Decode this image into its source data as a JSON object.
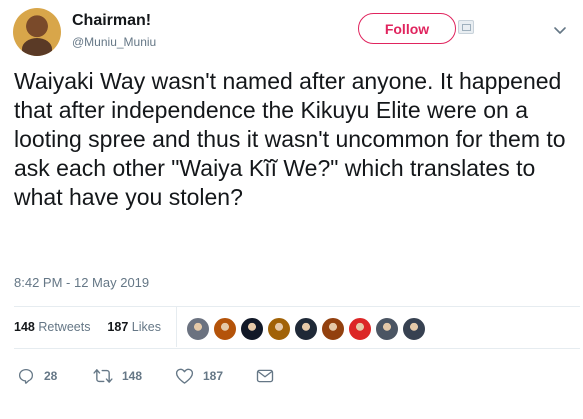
{
  "tweet": {
    "display_name": "Chairman!",
    "handle": "@Muniu_Muniu",
    "follow_label": "Follow",
    "text": "Waiyaki Way wasn't named after anyone. It happened that after independence the Kikuyu Elite were on a looting spree and thus it wasn't uncommon for them to ask each other \"Waiya Kĩĩ We?\" which translates to what have you stolen?",
    "timestamp": "8:42 PM - 12 May 2019"
  },
  "stats": {
    "retweets_count": "148",
    "retweets_label": "Retweets",
    "likes_count": "187",
    "likes_label": "Likes"
  },
  "liker_avatars": [
    {
      "color": "#6b7280"
    },
    {
      "color": "#b45309"
    },
    {
      "color": "#111827"
    },
    {
      "color": "#a16207"
    },
    {
      "color": "#1f2937"
    },
    {
      "color": "#92400e"
    },
    {
      "color": "#dc2626"
    },
    {
      "color": "#4b5563"
    },
    {
      "color": "#374151"
    }
  ],
  "actions": {
    "replies": "28",
    "retweets": "148",
    "likes": "187"
  },
  "colors": {
    "follow_accent": "#e0245e",
    "secondary_text": "#657786",
    "divider": "#e6ecf0"
  },
  "icons": {
    "chevron": "chevron-down-icon",
    "reply": "reply-icon",
    "retweet": "retweet-icon",
    "like": "heart-icon",
    "dm": "envelope-icon"
  }
}
